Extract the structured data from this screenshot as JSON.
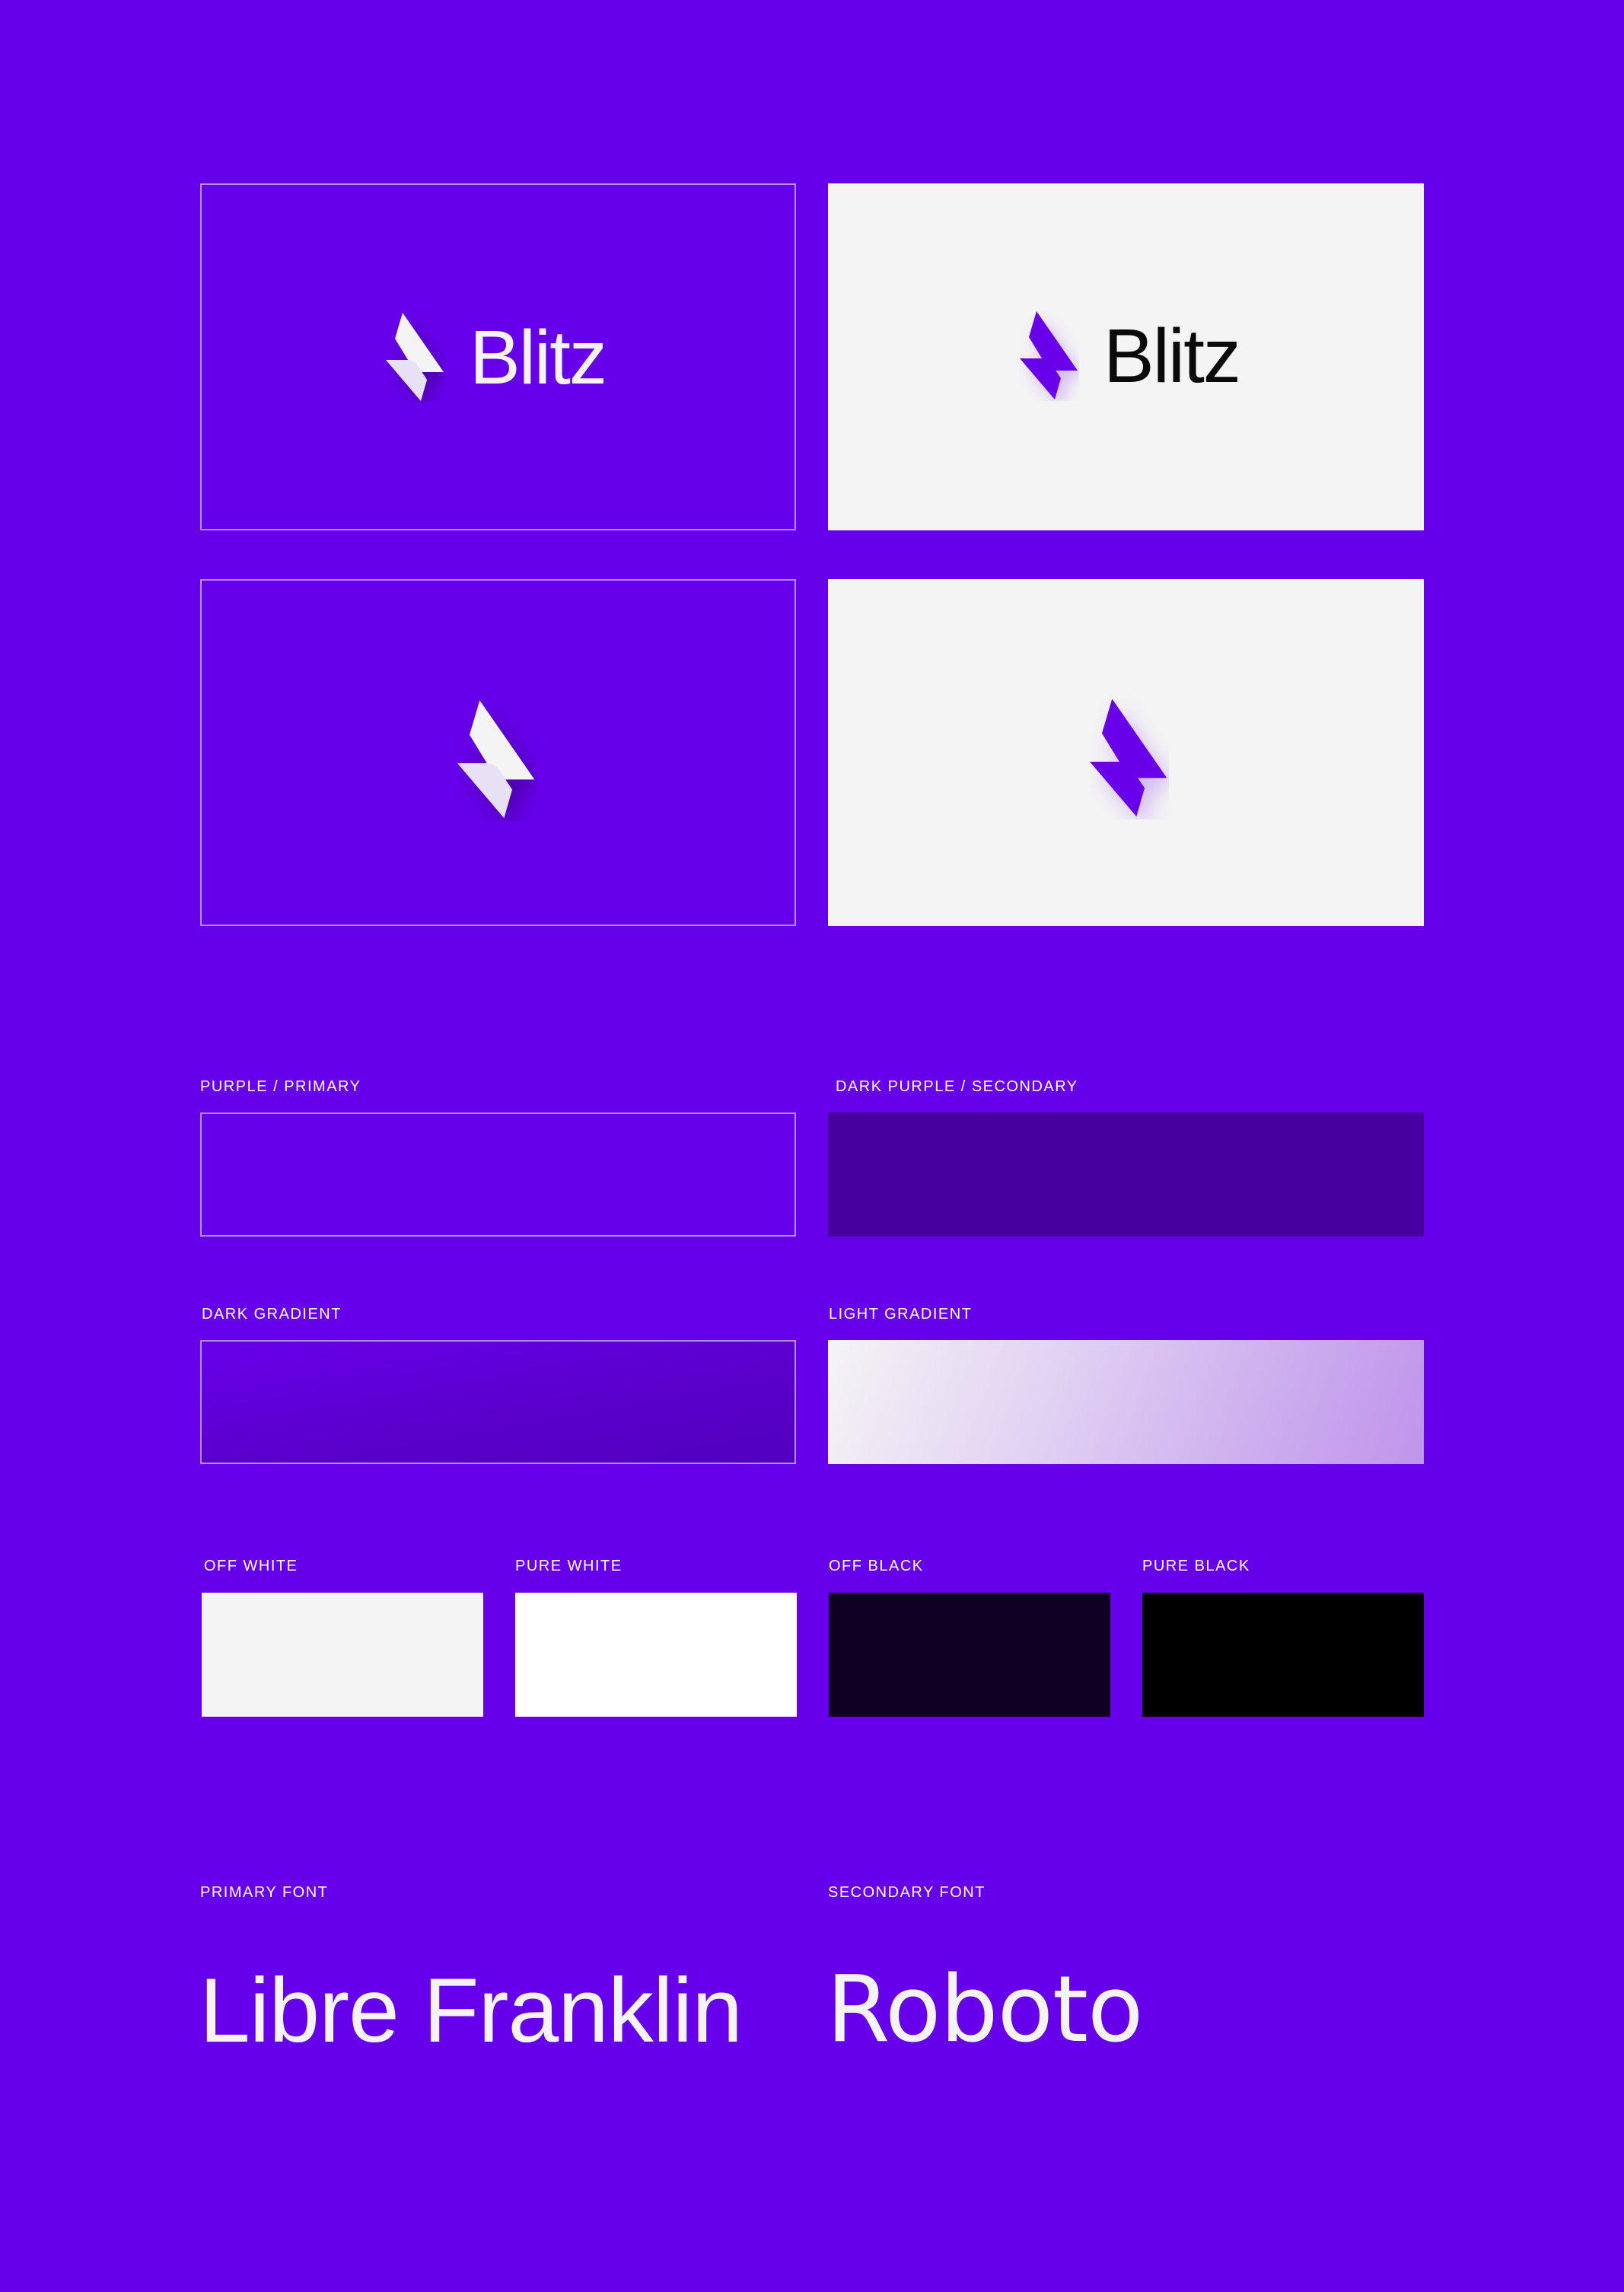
{
  "logos": {
    "wordmark": "Blitz",
    "mark_icon": "blitz-lightning-mark-icon"
  },
  "colors": {
    "primary": {
      "label": "PURPLE / PRIMARY",
      "hex": "#6700EA"
    },
    "secondary": {
      "label": "DARK PURPLE / SECONDARY",
      "hex": "#4600A0"
    },
    "dark_gradient": {
      "label": "DARK GRADIENT",
      "from": "#6700EA",
      "to": "#5200BE"
    },
    "light_gradient": {
      "label": "LIGHT GRADIENT",
      "from": "#F4F4F4",
      "to": "#BE95EB"
    },
    "off_white": {
      "label": "OFF WHITE",
      "hex": "#F4F4F4"
    },
    "pure_white": {
      "label": "PURE WHITE",
      "hex": "#FFFFFF"
    },
    "off_black": {
      "label": "OFF BLACK",
      "hex": "#0F0024"
    },
    "pure_black": {
      "label": "PURE BLACK",
      "hex": "#000000"
    }
  },
  "fonts": {
    "primary": {
      "label": "PRIMARY FONT",
      "sample": "Libre Franklin"
    },
    "secondary": {
      "label": "SECONDARY FONT",
      "sample": "Roboto"
    }
  }
}
